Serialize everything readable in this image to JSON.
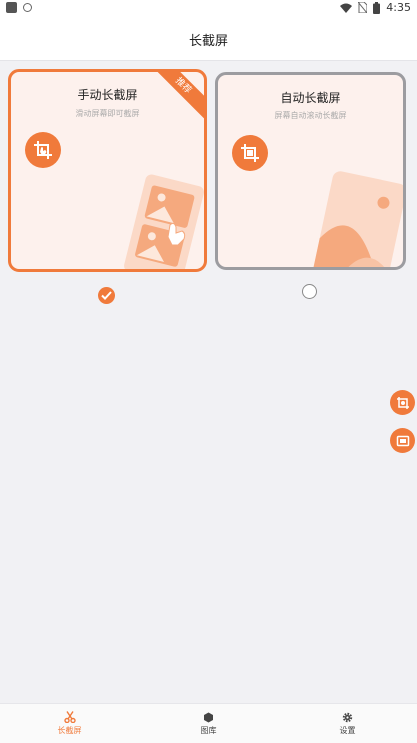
{
  "status_bar": {
    "time": "4:35"
  },
  "app_bar": {
    "title": "长截屏"
  },
  "cards": [
    {
      "title": "手动长截屏",
      "subtitle": "滑动屏幕即可截屏",
      "badge": "推荐",
      "selected": true,
      "icon": "manual-crop-icon"
    },
    {
      "title": "自动长截屏",
      "subtitle": "屏幕自动滚动长截屏",
      "selected": false,
      "icon": "auto-crop-icon"
    }
  ],
  "floating_buttons": [
    "crop-touch-icon",
    "screen-capture-icon"
  ],
  "bottom_nav": [
    {
      "label": "长截屏",
      "icon": "scissors-icon",
      "active": true
    },
    {
      "label": "图库",
      "icon": "hexagon-icon",
      "active": false
    },
    {
      "label": "设置",
      "icon": "gear-icon",
      "active": false
    }
  ],
  "colors": {
    "accent": "#f07a3b",
    "card_bg": "#fdf1ed",
    "page_bg": "#f1f1f4",
    "inactive_border": "#9c9ca0"
  }
}
